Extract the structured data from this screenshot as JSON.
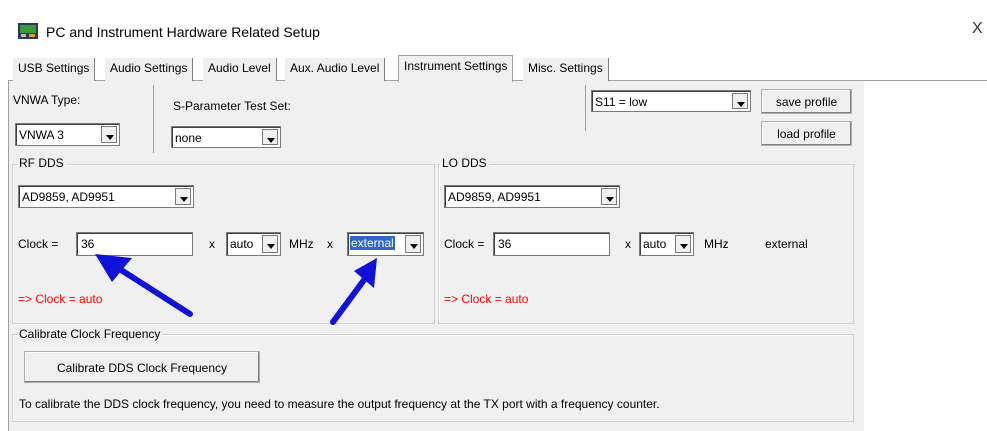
{
  "window": {
    "title": "PC and Instrument Hardware Related Setup",
    "close_glyph": "X"
  },
  "tabs": [
    {
      "label": "USB Settings"
    },
    {
      "label": "Audio Settings"
    },
    {
      "label": "Audio Level"
    },
    {
      "label": "Aux. Audio Level"
    },
    {
      "label": "Instrument Settings"
    },
    {
      "label": "Misc. Settings"
    }
  ],
  "active_tab": "Instrument Settings",
  "vnwa_type": {
    "label": "VNWA Type:",
    "value": "VNWA 3"
  },
  "sparam": {
    "label": "S-Parameter Test Set:",
    "value": "none"
  },
  "s11": {
    "value": "S11 = low"
  },
  "buttons": {
    "save_profile": "save profile",
    "load_profile": "load profile"
  },
  "rf_dds": {
    "title": "RF DDS",
    "chip": "AD9859, AD9951",
    "clock_label": "Clock =",
    "clock_value": "36",
    "x1": "x",
    "multiplier": "auto",
    "unit": "MHz",
    "x2": "x",
    "source": "external",
    "status": "=> Clock = auto"
  },
  "lo_dds": {
    "title": "LO DDS",
    "chip": "AD9859, AD9951",
    "clock_label": "Clock =",
    "clock_value": "36",
    "x1": "x",
    "multiplier": "auto",
    "unit": "MHz",
    "source": "external",
    "status": "=> Clock = auto"
  },
  "calibrate": {
    "title": "Calibrate Clock Frequency",
    "button": "Calibrate DDS Clock Frequency",
    "note": "To calibrate the DDS clock frequency, you need to measure the output frequency at the TX port with a frequency counter."
  },
  "colors": {
    "arrow": "#1010d8",
    "status": "#ff0000",
    "selection": "#3165ce"
  }
}
